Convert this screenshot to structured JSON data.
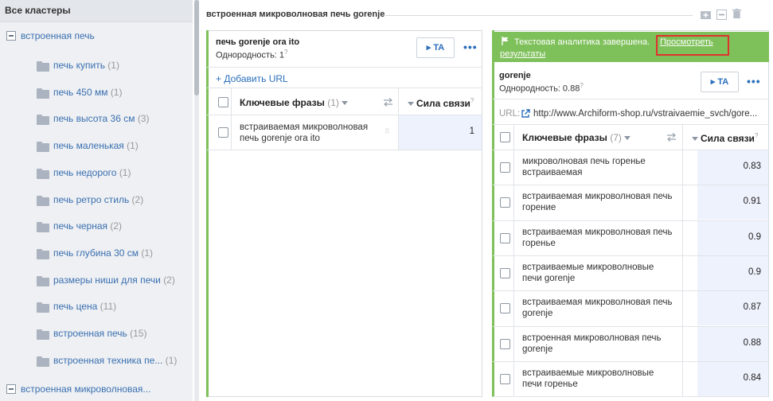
{
  "sidebar": {
    "header": "Все кластеры",
    "root": "встроенная печь",
    "items": [
      {
        "label": "печь купить",
        "count": "(1)"
      },
      {
        "label": "печь 450 мм",
        "count": "(1)"
      },
      {
        "label": "печь высота 36 см",
        "count": "(3)"
      },
      {
        "label": "печь маленькая",
        "count": "(1)"
      },
      {
        "label": "печь недорого",
        "count": "(1)"
      },
      {
        "label": "печь ретро стиль",
        "count": "(2)"
      },
      {
        "label": "печь черная",
        "count": "(2)"
      },
      {
        "label": "печь глубина 30 см",
        "count": "(1)"
      },
      {
        "label": "размеры ниши для печи",
        "count": "(2)"
      },
      {
        "label": "печь цена",
        "count": "(11)"
      },
      {
        "label": "встроенная печь",
        "count": "(15)"
      },
      {
        "label": "встроенная техника пе...",
        "count": "(1)"
      }
    ],
    "bottom": "встроенная микроволновая..."
  },
  "top": {
    "title": "встроенная микроволновая печь gorenje"
  },
  "left_panel": {
    "title": "печь gorenje ora ito",
    "homogeneity_label": "Однородность: 1",
    "sup": "?",
    "ta_label": "▸ TA",
    "more": "•••",
    "add_url": "+ Добавить URL",
    "col_phrases": "Ключевые фразы",
    "col_phrases_count": "(1)",
    "col_strength": "Сила связи",
    "rows": [
      {
        "phrase": "встраиваемая микроволновая печь gorenje ora ito",
        "value": "1"
      }
    ]
  },
  "right_panel": {
    "status_text": "Текстовая аналитика завершена.",
    "link_part1": "Просмотреть",
    "link_part2": "результаты",
    "title": "gorenje",
    "homogeneity_label": "Однородность: 0.88",
    "sup": "?",
    "ta_label": "▸ TA",
    "more": "•••",
    "url_label": "URL:",
    "url": "http://www.Archiform-shop.ru/vstraivaemie_svch/gore...",
    "col_phrases": "Ключевые фразы",
    "col_phrases_count": "(7)",
    "col_strength": "Сила связи",
    "rows": [
      {
        "phrase": "микроволновая печь горенье встраиваемая",
        "value": "0.83"
      },
      {
        "phrase": "встраиваемая микроволновая печь горение",
        "value": "0.91"
      },
      {
        "phrase": "встраиваемая микроволновая печь горенье",
        "value": "0.9"
      },
      {
        "phrase": "встраиваемые микроволновые печи gorenje",
        "value": "0.9"
      },
      {
        "phrase": "встраиваемая микроволновая печь gorenje",
        "value": "0.87"
      },
      {
        "phrase": "встроенная микроволновая печь gorenje",
        "value": "0.88"
      },
      {
        "phrase": "встраиваемые микроволновые печи горенье",
        "value": "0.84"
      }
    ]
  }
}
